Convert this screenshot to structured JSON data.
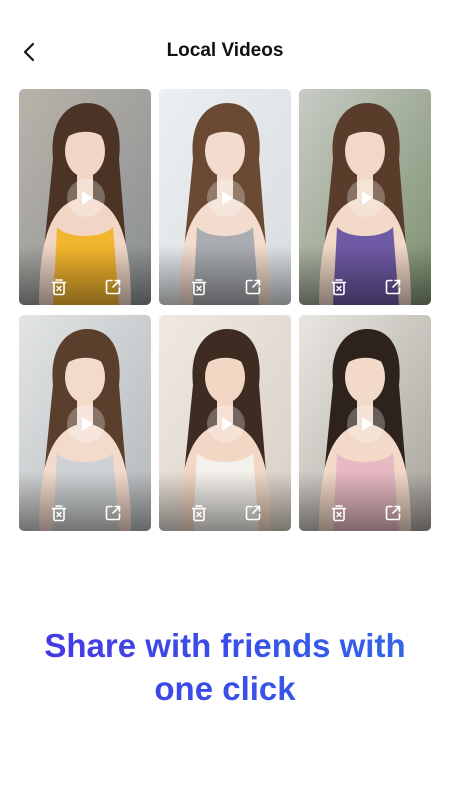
{
  "header": {
    "title": "Local Videos",
    "back_icon": "chevron-left-icon"
  },
  "videos": [
    {
      "scene": "street, yellow top, black jacket",
      "colors": {
        "bg1": "#8a8f92",
        "bg2": "#b9b3aa",
        "hair": "#4b3426",
        "skin": "#f1d6c6",
        "top": "#f2b52e"
      }
    },
    {
      "scene": "office, grey top",
      "colors": {
        "bg1": "#d9dde0",
        "bg2": "#eceff1",
        "hair": "#6b4a34",
        "skin": "#f3dccd",
        "top": "#a9acb0"
      }
    },
    {
      "scene": "outdoor trees, purple top",
      "colors": {
        "bg1": "#7c8f6e",
        "bg2": "#c8cbc5",
        "hair": "#5a3c2a",
        "skin": "#f2d8c7",
        "top": "#6f5aa6"
      }
    },
    {
      "scene": "window, light grey top",
      "colors": {
        "bg1": "#b4b8bb",
        "bg2": "#e2e4e5",
        "hair": "#5b3f2d",
        "skin": "#f3dbcc",
        "top": "#cfd2d4"
      }
    },
    {
      "scene": "sunlit room, sitting",
      "colors": {
        "bg1": "#d9d0c6",
        "bg2": "#efe9e2",
        "hair": "#3e2b21",
        "skin": "#f1d7c4",
        "top": "#f4f1ec"
      }
    },
    {
      "scene": "bed, pink cardigan",
      "colors": {
        "bg1": "#a7a39c",
        "bg2": "#e9e6e1",
        "hair": "#2e221c",
        "skin": "#f2d9c8",
        "top": "#e7b9c3"
      }
    }
  ],
  "actions": {
    "delete_icon": "trash-icon",
    "share_icon": "share-icon",
    "play_icon": "play-icon"
  },
  "promo": {
    "line1": "Share with friends with",
    "line2": "one click"
  }
}
